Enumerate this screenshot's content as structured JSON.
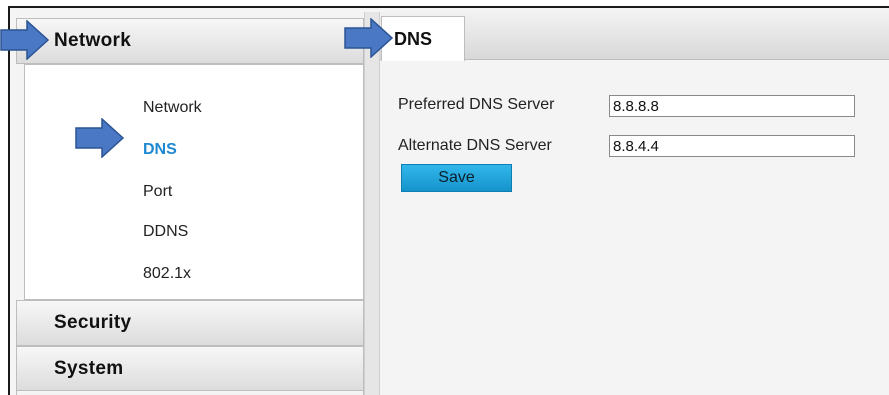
{
  "sidebar": {
    "network_header": "Network",
    "items": [
      {
        "label": "Network"
      },
      {
        "label": "DNS"
      },
      {
        "label": "Port"
      },
      {
        "label": "DDNS"
      },
      {
        "label": "802.1x"
      }
    ],
    "security_header": "Security",
    "system_header": "System"
  },
  "tabs": {
    "active": "DNS"
  },
  "form": {
    "preferred_label": "Preferred DNS Server",
    "preferred_value": "8.8.8.8",
    "alternate_label": "Alternate DNS Server",
    "alternate_value": "8.8.4.4",
    "save_label": "Save"
  },
  "colors": {
    "arrow_fill": "#4a78c4",
    "active_item": "#1e88d0",
    "save_button": "#22a6de"
  },
  "icons": [
    "arrow-pointer-icon"
  ]
}
